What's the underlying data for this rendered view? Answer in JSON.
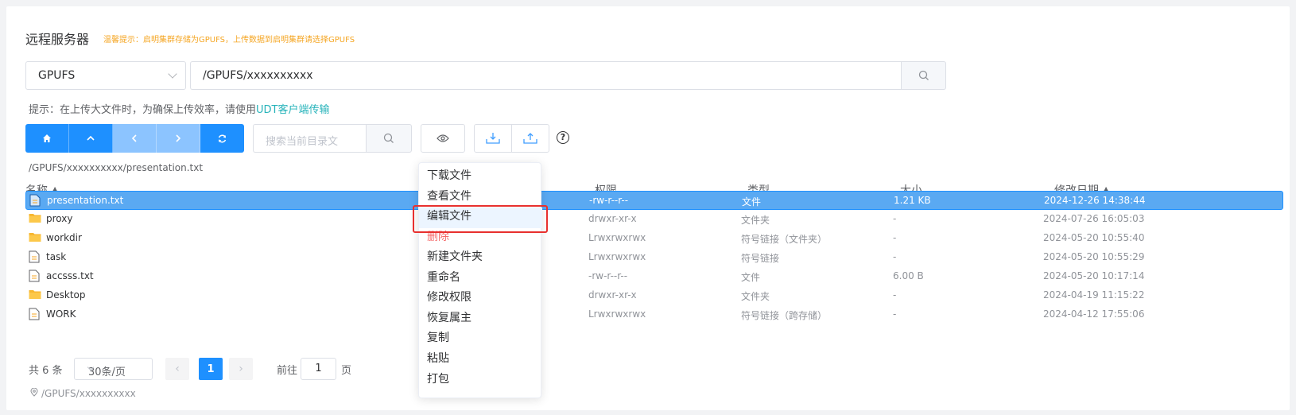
{
  "header": {
    "title": "远程服务器",
    "warning": "温馨提示：启明集群存储为GPUFS，上传数据到启明集群请选择GPUFS"
  },
  "storage_select": {
    "value": "GPUFS"
  },
  "path_input": {
    "value": "/GPUFS/xxxxxxxxxx"
  },
  "tip": {
    "text": "提示：在上传大文件时，为确保上传效率，请使用",
    "link": "UDT客户端传输"
  },
  "search": {
    "placeholder": "搜索当前目录文"
  },
  "breadcrumb": "/GPUFS/xxxxxxxxxx/presentation.txt",
  "table": {
    "headers": {
      "name": "名称",
      "perm": "权限",
      "type": "类型",
      "size": "大小",
      "date": "修改日期"
    },
    "rows": [
      {
        "name": "presentation.txt",
        "icon": "file-icon",
        "perm": "-rw-r--r--",
        "type": "文件",
        "size": "1.21 KB",
        "date": "2024-12-26 14:38:44",
        "selected": true
      },
      {
        "name": "proxy",
        "icon": "folder-icon",
        "perm": "drwxr-xr-x",
        "type": "文件夹",
        "size": "-",
        "date": "2024-07-26 16:05:03"
      },
      {
        "name": "workdir",
        "icon": "folder-icon",
        "perm": "Lrwxrwxrwx",
        "type": "符号链接（文件夹）",
        "size": "-",
        "date": "2024-05-20 10:55:40"
      },
      {
        "name": "task",
        "icon": "file-icon",
        "perm": "Lrwxrwxrwx",
        "type": "符号链接",
        "size": "-",
        "date": "2024-05-20 10:55:29"
      },
      {
        "name": "accsss.txt",
        "icon": "file-icon",
        "perm": "-rw-r--r--",
        "type": "文件",
        "size": "6.00 B",
        "date": "2024-05-20 10:17:14"
      },
      {
        "name": "Desktop",
        "icon": "folder-icon",
        "perm": "drwxr-xr-x",
        "type": "文件夹",
        "size": "-",
        "date": "2024-04-19 11:15:22"
      },
      {
        "name": "WORK",
        "icon": "file-icon",
        "perm": "Lrwxrwxrwx",
        "type": "符号链接（跨存储）",
        "size": "-",
        "date": "2024-04-12 17:55:06"
      }
    ]
  },
  "pager": {
    "total": "共 6 条",
    "page_size": "30条/页",
    "current": "1",
    "goto_label": "前往",
    "goto_value": "1",
    "page_suffix": "页"
  },
  "footer_path": "/GPUFS/xxxxxxxxxx",
  "context_menu": {
    "items": [
      {
        "label": "下载文件"
      },
      {
        "label": "查看文件"
      },
      {
        "label": "编辑文件",
        "highlighted": true
      },
      {
        "label": "删除",
        "danger": true
      },
      {
        "label": "新建文件夹"
      },
      {
        "label": "重命名"
      },
      {
        "label": "修改权限"
      },
      {
        "label": "恢复属主"
      },
      {
        "label": "复制"
      },
      {
        "label": "粘贴"
      },
      {
        "label": "打包"
      }
    ]
  },
  "colors": {
    "primary": "#1e90ff",
    "primary_light": "#8cc4ff",
    "warning": "#f5a623",
    "danger": "#f56c6c",
    "link": "#26b3ba",
    "highlight_box": "#e8302e"
  }
}
